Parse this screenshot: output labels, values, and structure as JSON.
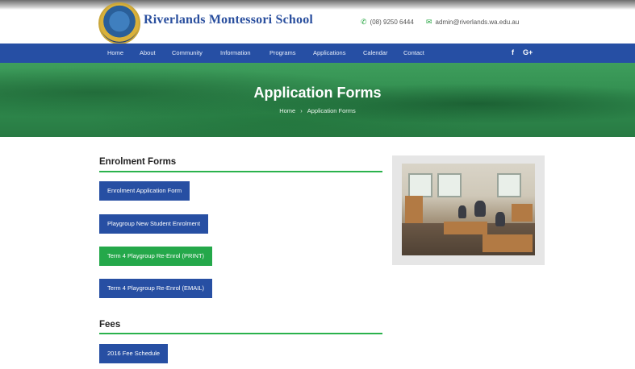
{
  "header": {
    "school_name": "Riverlands Montessori School",
    "phone": "(08) 9250 6444",
    "email": "admin@riverlands.wa.edu.au"
  },
  "nav": {
    "items": [
      "Home",
      "About",
      "Community",
      "Information",
      "Programs",
      "Applications",
      "Calendar",
      "Contact"
    ],
    "social": [
      "f",
      "G+"
    ]
  },
  "banner": {
    "title": "Application Forms",
    "breadcrumb": [
      "Home",
      "›",
      "Application Forms"
    ]
  },
  "sections": {
    "enrolment": {
      "title": "Enrolment Forms",
      "buttons": [
        "Enrolment Application Form",
        "Playgroup New Student Enrolment",
        "Term 4 Playgroup Re-Enrol (PRINT)",
        "Term 4 Playgroup Re-Enrol (EMAIL)"
      ]
    },
    "fees": {
      "title": "Fees",
      "buttons": [
        "2016 Fee Schedule"
      ]
    }
  },
  "colors": {
    "nav_blue": "#264fa4",
    "button_blue": "#274fa3",
    "button_green": "#24a84a",
    "accent_green": "#2bb24c"
  }
}
